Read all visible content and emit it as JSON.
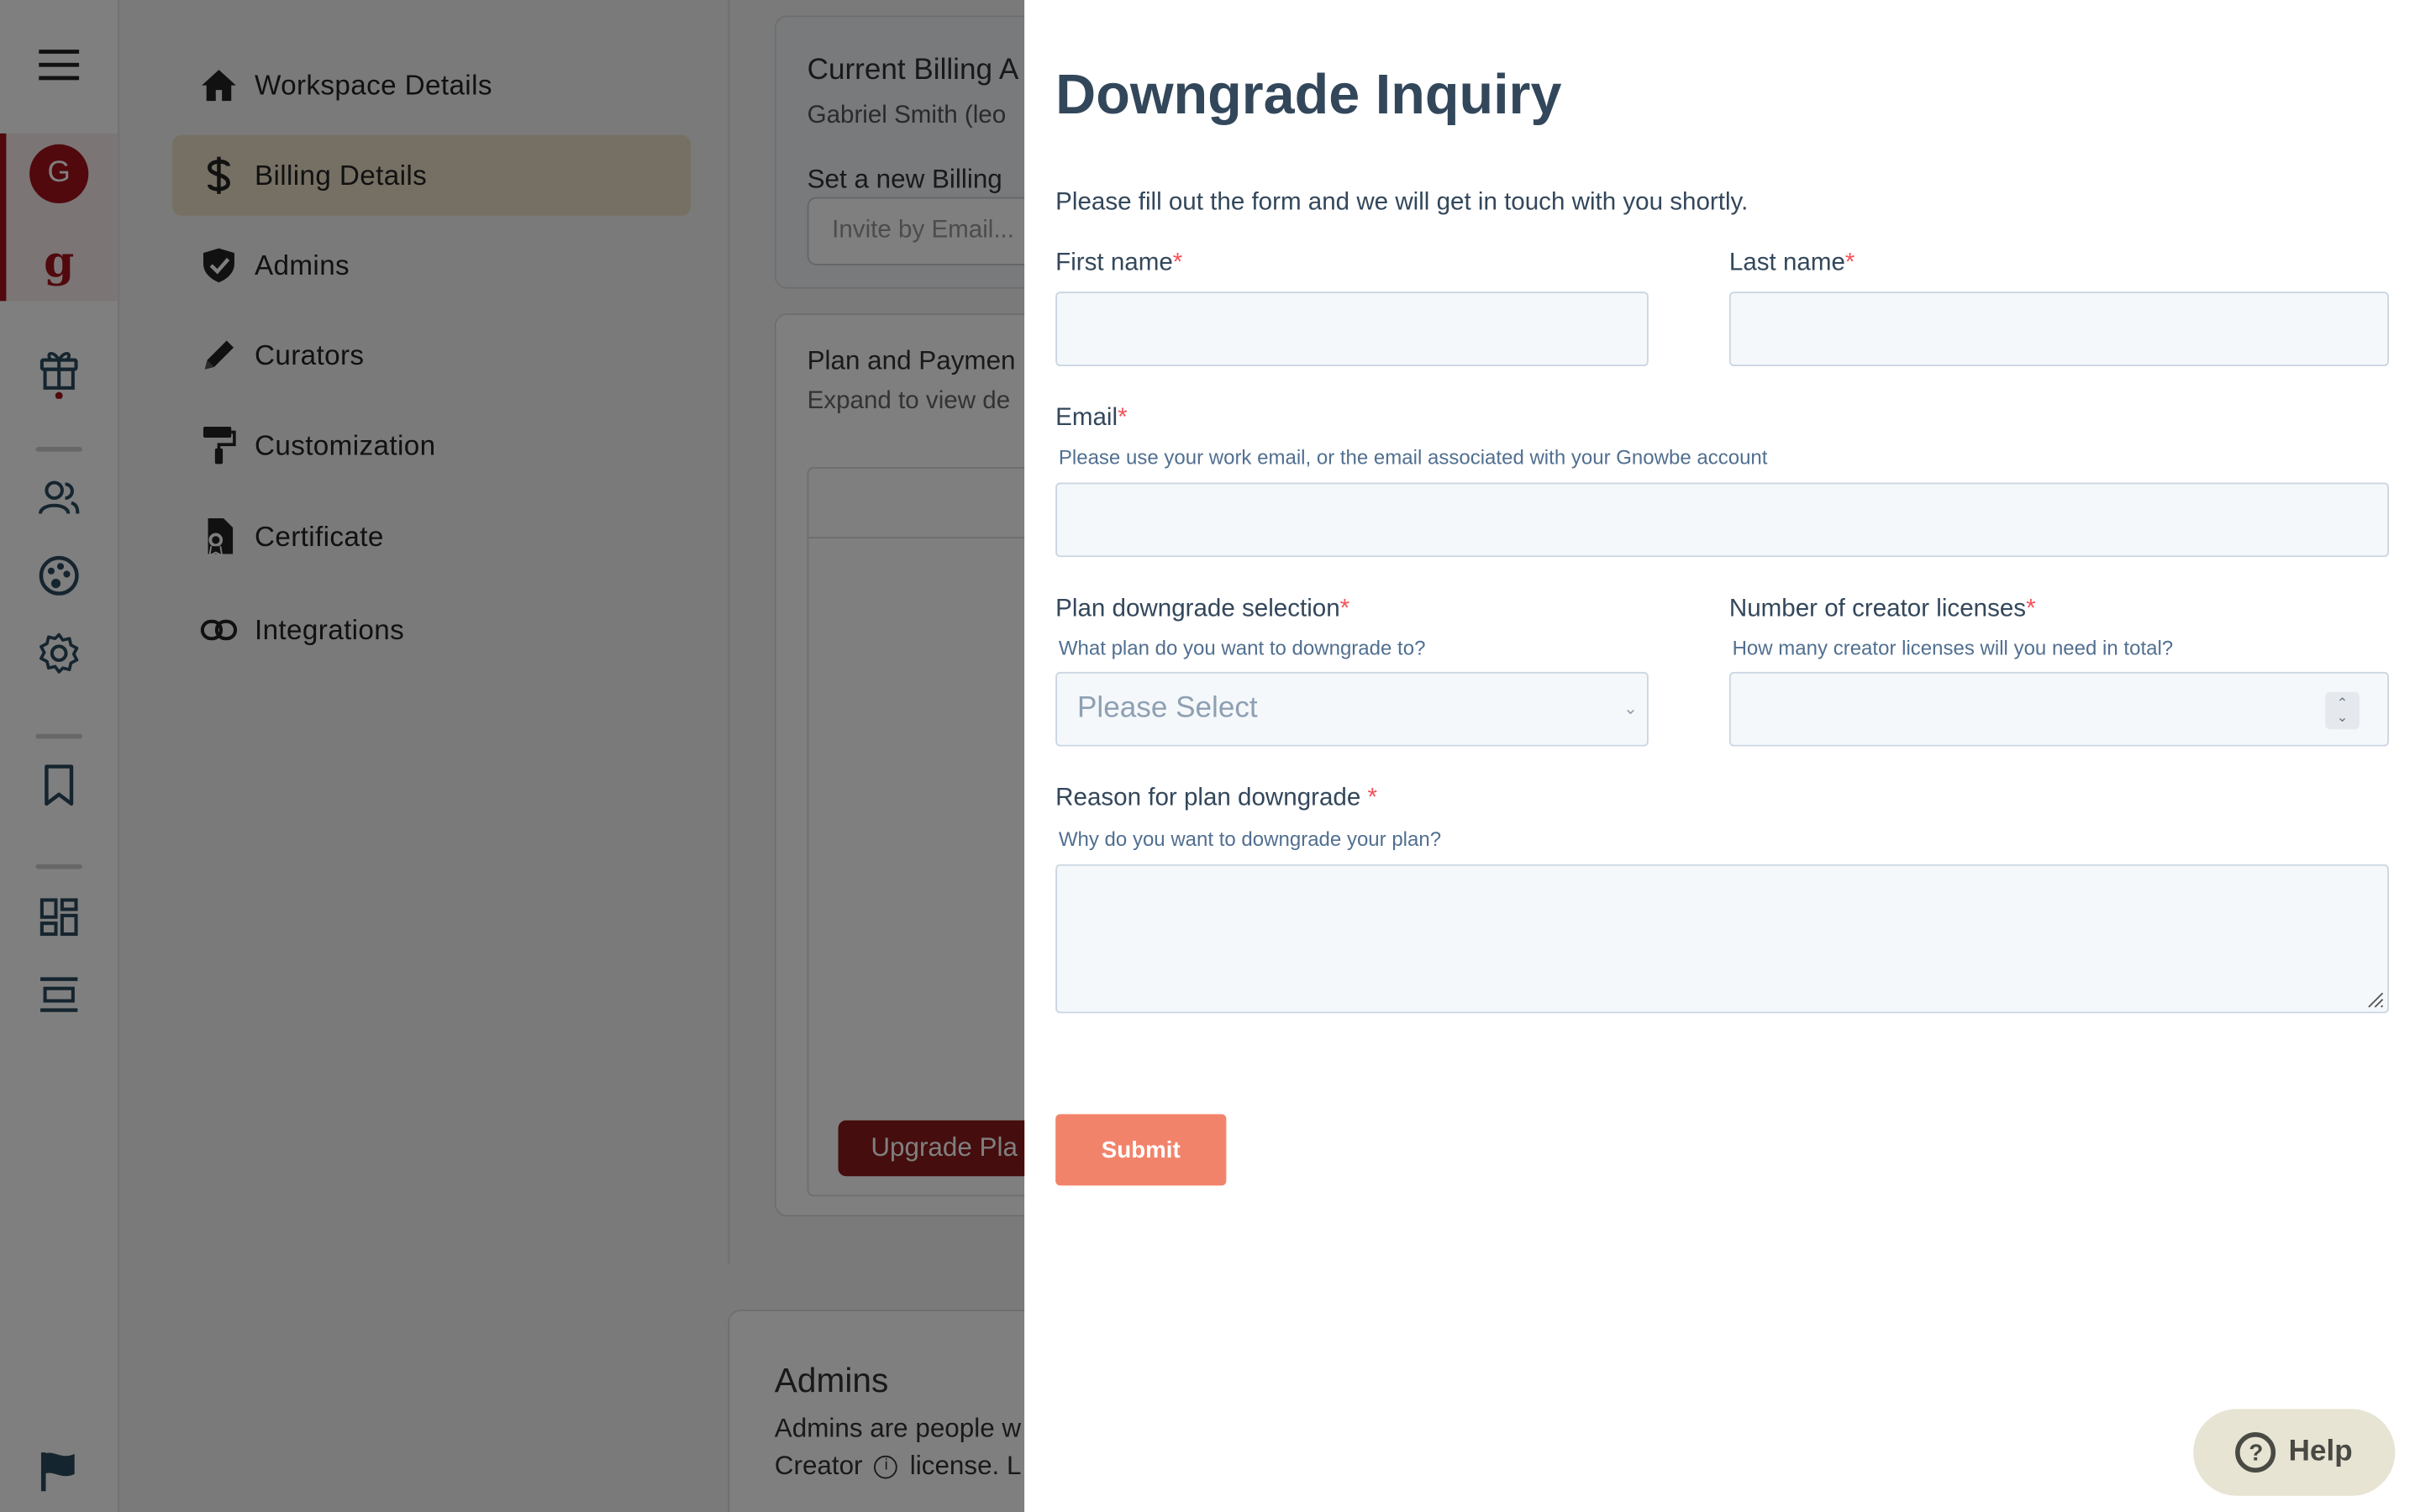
{
  "nav": {
    "items": [
      {
        "label": "Workspace Details",
        "icon": "home-icon"
      },
      {
        "label": "Billing Details",
        "icon": "dollar-icon",
        "active": true
      },
      {
        "label": "Admins",
        "icon": "shield-icon"
      },
      {
        "label": "Curators",
        "icon": "pencil-icon"
      },
      {
        "label": "Customization",
        "icon": "paint-roller-icon"
      },
      {
        "label": "Certificate",
        "icon": "certificate-icon"
      },
      {
        "label": "Integrations",
        "icon": "link-icon"
      }
    ]
  },
  "rail": {
    "avatar_letter": "G",
    "brand_letter": "g"
  },
  "background": {
    "billing_title": "Current Billing A",
    "billing_name": "Gabriel Smith (leo",
    "billing_set_label": "Set a new Billing",
    "billing_invite_placeholder": "Invite by Email...",
    "plan_title": "Plan and Paymen",
    "plan_sub": "Expand to view de",
    "upgrade_button": "Upgrade Pla",
    "admins_title": "Admins",
    "admins_text1": "Admins are people w",
    "admins_text2a": "Creator",
    "admins_text2b": "license. L"
  },
  "modal": {
    "title": "Downgrade Inquiry",
    "intro": "Please fill out the form and we will get in touch with you shortly.",
    "first_name_label": "First name",
    "last_name_label": "Last name",
    "email_label": "Email",
    "email_desc": "Please use your work email, or the email associated with your Gnowbe account",
    "plan_label": "Plan downgrade selection",
    "plan_desc": "What plan do you want to downgrade to?",
    "plan_placeholder": "Please Select",
    "licenses_label": "Number of creator licenses",
    "licenses_desc": "How many creator licenses will you need in total?",
    "reason_label": "Reason for plan downgrade ",
    "reason_desc": "Why do you want to downgrade your plan?",
    "required_mark": "*",
    "submit_label": "Submit"
  },
  "help": {
    "label": "Help"
  },
  "colors": {
    "brand_red": "#a3121a",
    "hubspot_text": "#33475b",
    "submit": "#f2836b"
  }
}
